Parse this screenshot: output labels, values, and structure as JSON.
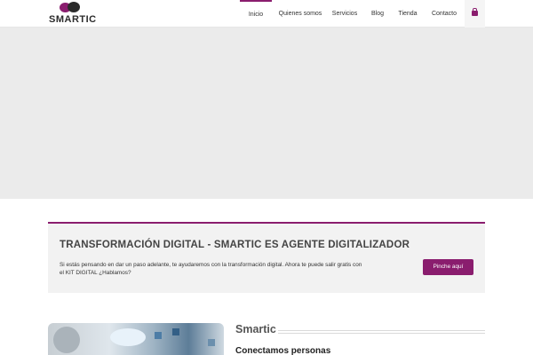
{
  "header": {
    "logo_text": "SMARTIC",
    "nav": [
      {
        "label": "Inicio",
        "active": true
      },
      {
        "label": "Quienes somos",
        "active": false
      },
      {
        "label": "Servicios",
        "active": false
      },
      {
        "label": "Blog",
        "active": false
      },
      {
        "label": "Tienda",
        "active": false
      },
      {
        "label": "Contacto",
        "active": false
      }
    ],
    "cart_icon": "shopping-bag-icon"
  },
  "banner": {
    "title": "TRANSFORMACIÓN DIGITAL - SMARTIC ES AGENTE DIGITALIZADOR",
    "text": "Si estás pensando en dar un paso adelante, te ayudaremos con la transformación digital. Ahora te puede salir gratis con el KIT DIGITAL ¿Hablamos?",
    "button_label": "Pinche aquí"
  },
  "section": {
    "title": "Smartic",
    "subtitle": "Conectamos personas"
  },
  "colors": {
    "accent": "#8a1d6e",
    "hero_bg": "#ebebeb",
    "banner_bg": "#f2f2f2"
  }
}
